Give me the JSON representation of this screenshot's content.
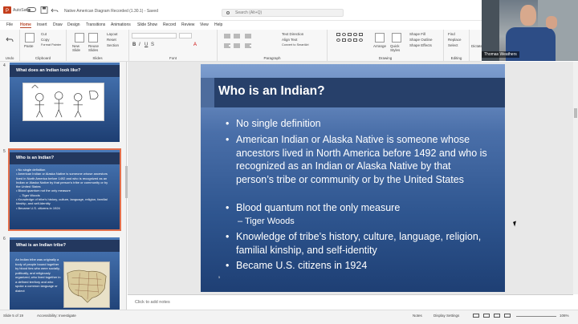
{
  "titlebar": {
    "autosave": "AutoSave",
    "toggle": "Off",
    "doc_title": "Native American Diagram Recorded (1.30.1) - Saved",
    "search_placeholder": "Search (Alt+Q)"
  },
  "menu": [
    "File",
    "Home",
    "Insert",
    "Draw",
    "Design",
    "Transitions",
    "Animations",
    "Slide Show",
    "Record",
    "Review",
    "View",
    "Help"
  ],
  "ribbon": {
    "clipboard": "Clipboard",
    "paste": "Paste",
    "cut": "Cut",
    "copy": "Copy",
    "format": "Format Painter",
    "new_slide": "New Slide",
    "reuse": "Reuse Slides",
    "layout": "Layout",
    "reset": "Reset",
    "section": "Section",
    "slides": "Slides",
    "font": "Font",
    "paragraph": "Paragraph",
    "text_direction": "Text Direction",
    "align_text": "Align Text",
    "smartart": "Convert to SmartArt",
    "drawing": "Drawing",
    "arrange": "Arrange",
    "quick_styles": "Quick Styles",
    "shape_fill": "Shape Fill",
    "shape_outline": "Shape Outline",
    "shape_effects": "Shape Effects",
    "find": "Find",
    "replace": "Replace",
    "select": "Select",
    "editing": "Editing",
    "dictate": "Dictate",
    "undo": "Undo"
  },
  "video": {
    "name": "Thomas Weathers"
  },
  "thumbs": [
    {
      "num": "4",
      "title": "What does an Indian look like?"
    },
    {
      "num": "5",
      "title": "Who is an Indian?",
      "bullets": [
        "No single definition",
        "American Indian or Alaska Native is someone whose ancestors lived in North America before 1492 and who is recognized as an Indian or Alaska Native by that person's tribe or community or by the United States",
        "Blood quantum not the only measure",
        "– Tiger Woods",
        "Knowledge of tribe's history, culture, language, religion, familial kinship, and self-identity",
        "Became U.S. citizens in 1924"
      ]
    },
    {
      "num": "6",
      "title": "What is an Indian tribe?",
      "text": "An Indian tribe was originally a body of people bound together by blood ties who were socially, politically, and religiously organized, who lived together in a defined territory and who spoke a common language or dialect"
    }
  ],
  "slide": {
    "title": "Who is an Indian?",
    "number": "5",
    "bullets": [
      "No single definition",
      "American Indian or Alaska Native is someone whose ancestors lived in North America before 1492 and who is recognized as an Indian or Alaska Native by that person’s tribe or community or by the United States",
      "Blood quantum not the only measure",
      "Knowledge of tribe’s history, culture, language, religion, familial kinship, and self-identity",
      "Became U.S. citizens in 1924"
    ],
    "sub_bullet": "Tiger Woods"
  },
  "notes_placeholder": "Click to add notes",
  "status": {
    "slide": "Slide 5 of 19",
    "accessibility": "Accessibility: Investigate",
    "notes": "Notes",
    "display": "Display Settings",
    "zoom": "106%"
  }
}
